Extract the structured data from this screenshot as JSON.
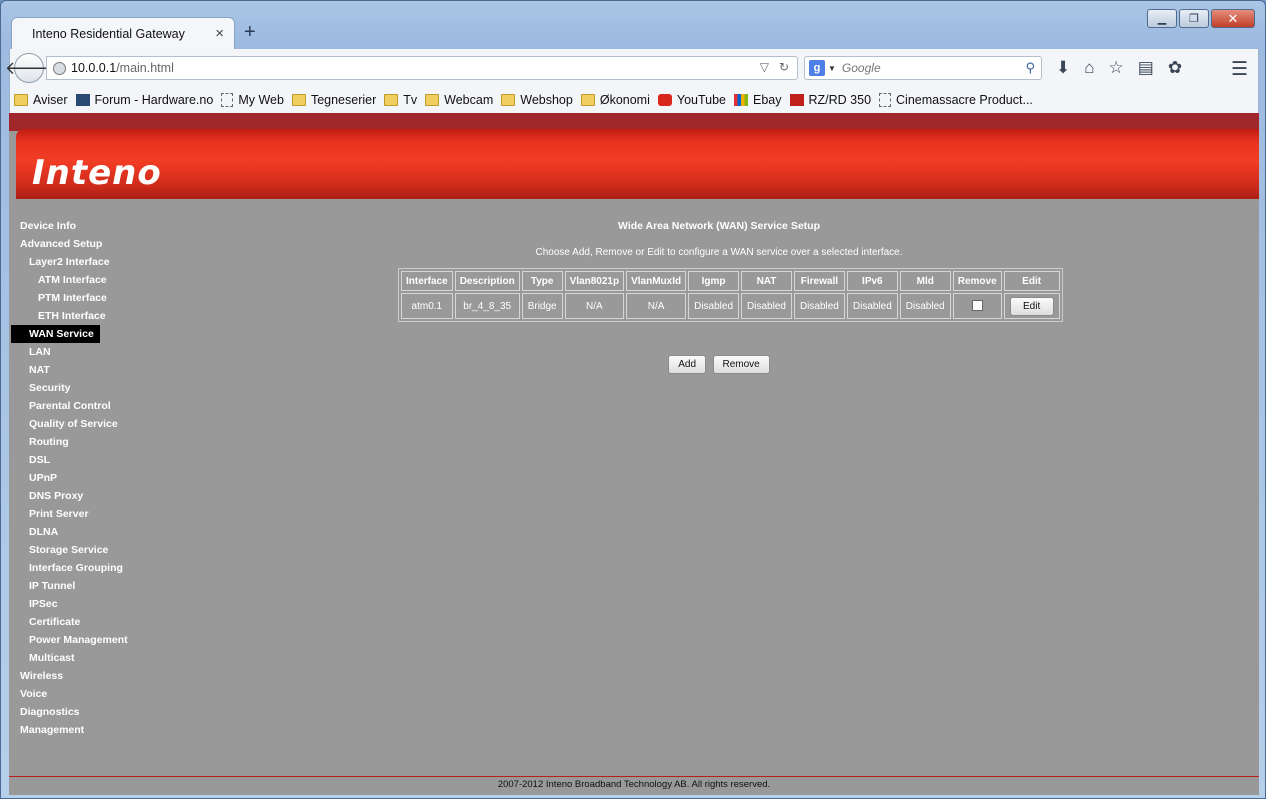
{
  "browser": {
    "tab_title": "Inteno Residential Gateway",
    "tab_close": "×",
    "new_tab": "+",
    "url_host": "10.0.0.1",
    "url_path": "/main.html",
    "search_placeholder": "Google",
    "window_controls": {
      "minimize": "▁",
      "maximize": "❐",
      "close": "✕"
    }
  },
  "bookmarks": [
    {
      "label": "Aviser",
      "icon": "folder"
    },
    {
      "label": "Forum - Hardware.no",
      "icon": "hw"
    },
    {
      "label": "My Web",
      "icon": "page"
    },
    {
      "label": "Tegneserier",
      "icon": "folder"
    },
    {
      "label": "Tv",
      "icon": "folder"
    },
    {
      "label": "Webcam",
      "icon": "folder"
    },
    {
      "label": "Webshop",
      "icon": "folder"
    },
    {
      "label": "Økonomi",
      "icon": "folder"
    },
    {
      "label": "YouTube",
      "icon": "yt"
    },
    {
      "label": "Ebay",
      "icon": "ebay"
    },
    {
      "label": "RZ/RD 350",
      "icon": "rz"
    },
    {
      "label": "Cinemassacre Product...",
      "icon": "page"
    }
  ],
  "logo": "Inteno",
  "sidebar": [
    {
      "label": "Device Info",
      "level": 0
    },
    {
      "label": "Advanced Setup",
      "level": 0
    },
    {
      "label": "Layer2 Interface",
      "level": 1
    },
    {
      "label": "ATM Interface",
      "level": 2
    },
    {
      "label": "PTM Interface",
      "level": 2
    },
    {
      "label": "ETH Interface",
      "level": 2
    },
    {
      "label": "WAN Service",
      "level": 1,
      "active": true
    },
    {
      "label": "LAN",
      "level": 1
    },
    {
      "label": "NAT",
      "level": 1
    },
    {
      "label": "Security",
      "level": 1
    },
    {
      "label": "Parental Control",
      "level": 1
    },
    {
      "label": "Quality of Service",
      "level": 1
    },
    {
      "label": "Routing",
      "level": 1
    },
    {
      "label": "DSL",
      "level": 1
    },
    {
      "label": "UPnP",
      "level": 1
    },
    {
      "label": "DNS Proxy",
      "level": 1
    },
    {
      "label": "Print Server",
      "level": 1
    },
    {
      "label": "DLNA",
      "level": 1
    },
    {
      "label": "Storage Service",
      "level": 1
    },
    {
      "label": "Interface Grouping",
      "level": 1
    },
    {
      "label": "IP Tunnel",
      "level": 1
    },
    {
      "label": "IPSec",
      "level": 1
    },
    {
      "label": "Certificate",
      "level": 1
    },
    {
      "label": "Power Management",
      "level": 1
    },
    {
      "label": "Multicast",
      "level": 1
    },
    {
      "label": "Wireless",
      "level": 0
    },
    {
      "label": "Voice",
      "level": 0
    },
    {
      "label": "Diagnostics",
      "level": 0
    },
    {
      "label": "Management",
      "level": 0
    }
  ],
  "main": {
    "title": "Wide Area Network (WAN) Service Setup",
    "description": "Choose Add, Remove or Edit to configure a WAN service over a selected interface.",
    "columns": [
      "Interface",
      "Description",
      "Type",
      "Vlan8021p",
      "VlanMuxId",
      "Igmp",
      "NAT",
      "Firewall",
      "IPv6",
      "Mld",
      "Remove",
      "Edit"
    ],
    "rows": [
      {
        "cells": [
          "atm0.1",
          "br_4_8_35",
          "Bridge",
          "N/A",
          "N/A",
          "Disabled",
          "Disabled",
          "Disabled",
          "Disabled",
          "Disabled"
        ],
        "edit_label": "Edit"
      }
    ],
    "add_label": "Add",
    "remove_label": "Remove"
  },
  "footer": "2007-2012 Inteno Broadband Technology AB. All rights reserved."
}
